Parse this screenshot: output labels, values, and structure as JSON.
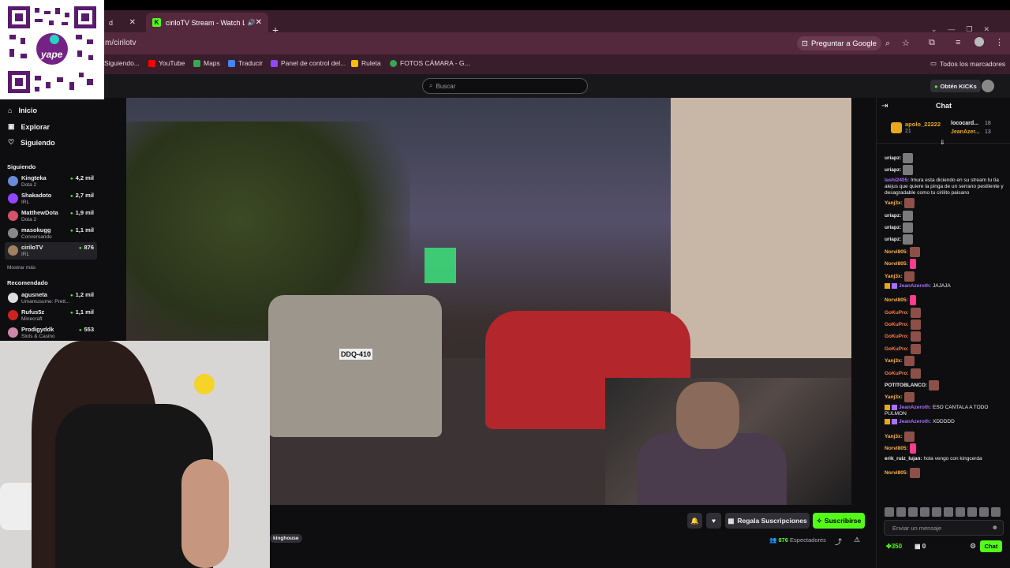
{
  "browser": {
    "tabs": [
      {
        "label": "d",
        "close": "✕"
      },
      {
        "label": "ciriloTV Stream - Watch Live",
        "close": "✕"
      }
    ],
    "new_tab": "+",
    "url": "m/cirilotv",
    "ask_google": "Preguntar a Google",
    "bookmarks": [
      "Siguiendo...",
      "YouTube",
      "Maps",
      "Traducir",
      "Panel de control del...",
      "Ruleta",
      "FOTOS CÁMARA - G..."
    ],
    "all_bookmarks": "Todos los marcadores"
  },
  "header": {
    "search_placeholder": "Buscar",
    "get_kicks": "Obtén KICKs"
  },
  "qr": {
    "brand": "yape"
  },
  "sidebar": {
    "nav": [
      "Inicio",
      "Explorar",
      "Siguiendo"
    ],
    "following_title": "Siguiendo",
    "following": [
      {
        "name": "Kingteka",
        "category": "Dota 2",
        "viewers": "4,2 mil",
        "color": "#6b8bd6"
      },
      {
        "name": "Shakadoto",
        "category": "IRL",
        "viewers": "2,7 mil",
        "color": "#9146ff"
      },
      {
        "name": "MatthewDota",
        "category": "Dota 2",
        "viewers": "1,9 mil",
        "color": "#d6536b"
      },
      {
        "name": "masokugg",
        "category": "Conversando",
        "viewers": "1,1 mil",
        "color": "#888"
      },
      {
        "name": "ciriloTV",
        "category": "IRL",
        "viewers": "876",
        "color": "#a08060"
      }
    ],
    "show_more": "Mostrar más",
    "recommended_title": "Recomendado",
    "recommended": [
      {
        "name": "agusneta",
        "category": "Umamusume: Prett...",
        "viewers": "1,2 mil",
        "color": "#ddd"
      },
      {
        "name": "Rufus5z",
        "category": "Minecraft",
        "viewers": "1,1 mil",
        "color": "#c22"
      },
      {
        "name": "Prodigyddk",
        "category": "Slots & Casino",
        "viewers": "553",
        "color": "#c8a"
      }
    ]
  },
  "video": {
    "plate": "DDQ-410"
  },
  "below_video": {
    "tag": "kinghouse",
    "gift_label": "Regala Suscripciones",
    "subscribe_label": "Suscribirse",
    "viewer_count": "876",
    "viewer_word": "Espectadores"
  },
  "chat": {
    "title": "Chat",
    "leaderboard": [
      {
        "name": "apolo_22222",
        "value": "21"
      },
      {
        "name": "lococard...",
        "value": "18"
      },
      {
        "name": "JeanAzer...",
        "value": "13"
      }
    ],
    "messages": [
      {
        "user": "uriapz:",
        "text": "",
        "color": "#efeff1",
        "emote": "gray"
      },
      {
        "user": "uriapz:",
        "text": "",
        "color": "#efeff1",
        "emote": "gray"
      },
      {
        "user": "lashi2405:",
        "text": " lmura esta diciendo en su stream tu tia alejus que quiere la pinga de un serrano pestilente y desagradable como tu cirilito paisano",
        "color": "#a970ff",
        "emote": ""
      },
      {
        "user": "Yanj3x:",
        "text": "",
        "color": "#ffb347",
        "emote": "brown"
      },
      {
        "user": "uriapz:",
        "text": "",
        "color": "#efeff1",
        "emote": "gray"
      },
      {
        "user": "uriapz:",
        "text": "",
        "color": "#efeff1",
        "emote": "gray"
      },
      {
        "user": "uriapz:",
        "text": "",
        "color": "#efeff1",
        "emote": "gray"
      },
      {
        "user": "Norvi805:",
        "text": "",
        "color": "#ffb347",
        "emote": "brown"
      },
      {
        "user": "Norvi805:",
        "text": "",
        "color": "#ffb347",
        "emote": "pink"
      },
      {
        "user": "Yanj3x:",
        "text": "",
        "color": "#ffb347",
        "emote": "brown"
      },
      {
        "user": "JeanAzeroth:",
        "text": " JAJAJA",
        "color": "#a970ff",
        "emote": "",
        "badges": true
      },
      {
        "user": "Norvi805:",
        "text": "",
        "color": "#ffb347",
        "emote": "pink"
      },
      {
        "user": "GoKuPro:",
        "text": "",
        "color": "#ff7a45",
        "emote": "brown"
      },
      {
        "user": "GoKuPro:",
        "text": "",
        "color": "#ff7a45",
        "emote": "brown"
      },
      {
        "user": "GoKuPro:",
        "text": "",
        "color": "#ff7a45",
        "emote": "brown"
      },
      {
        "user": "GoKuPro:",
        "text": "",
        "color": "#ff7a45",
        "emote": "brown"
      },
      {
        "user": "Yanj3x:",
        "text": "",
        "color": "#ffb347",
        "emote": "brown"
      },
      {
        "user": "GoKuPro:",
        "text": "",
        "color": "#ff7a45",
        "emote": "brown"
      },
      {
        "user": "POTITOBLANCO:",
        "text": "",
        "color": "#efeff1",
        "emote": "brown"
      },
      {
        "user": "Yanj3x:",
        "text": "",
        "color": "#ffb347",
        "emote": "brown"
      },
      {
        "user": "JeanAzeroth:",
        "text": " ESO CANTALA A TODO PULMON",
        "color": "#a970ff",
        "emote": "",
        "badges": true
      },
      {
        "user": "JeanAzeroth:",
        "text": " XDDDDD",
        "color": "#a970ff",
        "emote": "",
        "badges": true
      },
      {
        "user": "Yanj3x:",
        "text": "",
        "color": "#ffb347",
        "emote": "brown"
      },
      {
        "user": "Norvi805:",
        "text": "",
        "color": "#ffb347",
        "emote": "pink"
      },
      {
        "user": "erik_ruiz_lujan:",
        "text": " hola vengo con kingcerda",
        "color": "#efeff1",
        "emote": ""
      },
      {
        "user": "Norvi805:",
        "text": "",
        "color": "#ffb347",
        "emote": "brown"
      }
    ],
    "input_placeholder": "Enviar un mensaje",
    "points": "350",
    "zero": "0",
    "send_label": "Chat"
  }
}
